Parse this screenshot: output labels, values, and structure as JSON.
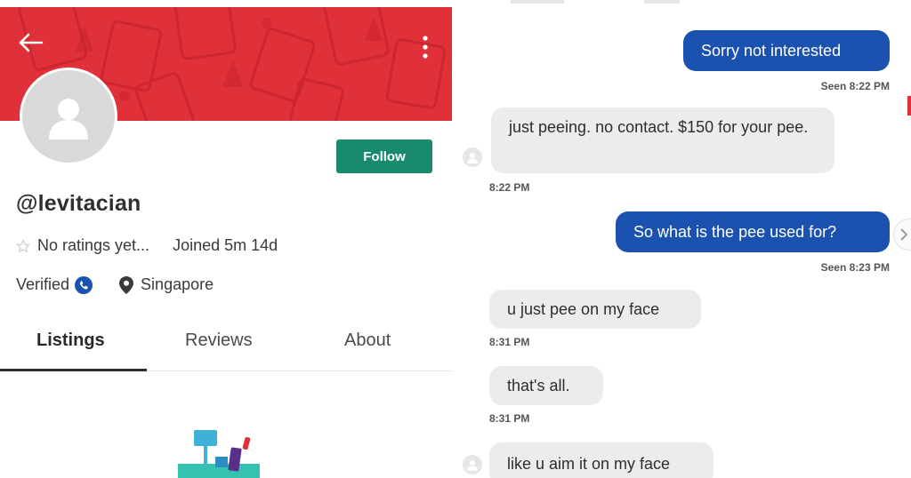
{
  "profile": {
    "username": "@levitacian",
    "ratings_text": "No ratings yet...",
    "joined_text": "Joined 5m 14d",
    "verified_label": "Verified",
    "location": "Singapore",
    "follow_label": "Follow",
    "tabs": [
      {
        "label": "Listings",
        "active": true
      },
      {
        "label": "Reviews",
        "active": false
      },
      {
        "label": "About",
        "active": false
      }
    ],
    "icons": {
      "back": "back-arrow-icon",
      "more": "more-vertical-icon",
      "avatar": "user-silhouette-icon",
      "star": "star-icon",
      "verified": "phone-verified-icon",
      "location": "location-pin-icon"
    },
    "colors": {
      "banner": "#e0303a",
      "follow_button": "#1a8a6e",
      "verified_icon": "#1b52b0"
    }
  },
  "chat": {
    "messages": [
      {
        "direction": "out",
        "text": "Sorry not interested",
        "status": "Seen  8:22 PM"
      },
      {
        "direction": "in",
        "text": "just peeing. no contact. $150 for your pee.",
        "time": "8:22 PM"
      },
      {
        "direction": "out",
        "text": "So what is the pee used for?",
        "status": "Seen  8:23 PM"
      },
      {
        "direction": "in",
        "text": "u just pee on my face",
        "time": "8:31 PM"
      },
      {
        "direction": "in",
        "text": "that's all.",
        "time": "8:31 PM"
      },
      {
        "direction": "in",
        "text": "like u aim it on my face",
        "time": ""
      }
    ],
    "colors": {
      "outgoing_bubble": "#1b52b0",
      "incoming_bubble": "#ececec"
    }
  }
}
